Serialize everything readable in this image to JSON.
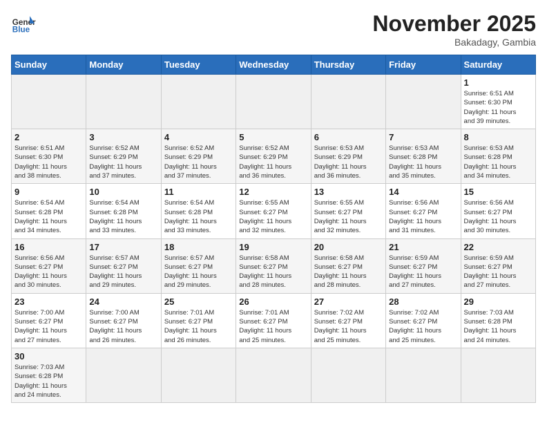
{
  "header": {
    "logo_general": "General",
    "logo_blue": "Blue",
    "month": "November 2025",
    "location": "Bakadagy, Gambia"
  },
  "weekdays": [
    "Sunday",
    "Monday",
    "Tuesday",
    "Wednesday",
    "Thursday",
    "Friday",
    "Saturday"
  ],
  "weeks": [
    [
      {
        "day": "",
        "info": ""
      },
      {
        "day": "",
        "info": ""
      },
      {
        "day": "",
        "info": ""
      },
      {
        "day": "",
        "info": ""
      },
      {
        "day": "",
        "info": ""
      },
      {
        "day": "",
        "info": ""
      },
      {
        "day": "1",
        "info": "Sunrise: 6:51 AM\nSunset: 6:30 PM\nDaylight: 11 hours\nand 39 minutes."
      }
    ],
    [
      {
        "day": "2",
        "info": "Sunrise: 6:51 AM\nSunset: 6:30 PM\nDaylight: 11 hours\nand 38 minutes."
      },
      {
        "day": "3",
        "info": "Sunrise: 6:52 AM\nSunset: 6:29 PM\nDaylight: 11 hours\nand 37 minutes."
      },
      {
        "day": "4",
        "info": "Sunrise: 6:52 AM\nSunset: 6:29 PM\nDaylight: 11 hours\nand 37 minutes."
      },
      {
        "day": "5",
        "info": "Sunrise: 6:52 AM\nSunset: 6:29 PM\nDaylight: 11 hours\nand 36 minutes."
      },
      {
        "day": "6",
        "info": "Sunrise: 6:53 AM\nSunset: 6:29 PM\nDaylight: 11 hours\nand 36 minutes."
      },
      {
        "day": "7",
        "info": "Sunrise: 6:53 AM\nSunset: 6:28 PM\nDaylight: 11 hours\nand 35 minutes."
      },
      {
        "day": "8",
        "info": "Sunrise: 6:53 AM\nSunset: 6:28 PM\nDaylight: 11 hours\nand 34 minutes."
      }
    ],
    [
      {
        "day": "9",
        "info": "Sunrise: 6:54 AM\nSunset: 6:28 PM\nDaylight: 11 hours\nand 34 minutes."
      },
      {
        "day": "10",
        "info": "Sunrise: 6:54 AM\nSunset: 6:28 PM\nDaylight: 11 hours\nand 33 minutes."
      },
      {
        "day": "11",
        "info": "Sunrise: 6:54 AM\nSunset: 6:28 PM\nDaylight: 11 hours\nand 33 minutes."
      },
      {
        "day": "12",
        "info": "Sunrise: 6:55 AM\nSunset: 6:27 PM\nDaylight: 11 hours\nand 32 minutes."
      },
      {
        "day": "13",
        "info": "Sunrise: 6:55 AM\nSunset: 6:27 PM\nDaylight: 11 hours\nand 32 minutes."
      },
      {
        "day": "14",
        "info": "Sunrise: 6:56 AM\nSunset: 6:27 PM\nDaylight: 11 hours\nand 31 minutes."
      },
      {
        "day": "15",
        "info": "Sunrise: 6:56 AM\nSunset: 6:27 PM\nDaylight: 11 hours\nand 30 minutes."
      }
    ],
    [
      {
        "day": "16",
        "info": "Sunrise: 6:56 AM\nSunset: 6:27 PM\nDaylight: 11 hours\nand 30 minutes."
      },
      {
        "day": "17",
        "info": "Sunrise: 6:57 AM\nSunset: 6:27 PM\nDaylight: 11 hours\nand 29 minutes."
      },
      {
        "day": "18",
        "info": "Sunrise: 6:57 AM\nSunset: 6:27 PM\nDaylight: 11 hours\nand 29 minutes."
      },
      {
        "day": "19",
        "info": "Sunrise: 6:58 AM\nSunset: 6:27 PM\nDaylight: 11 hours\nand 28 minutes."
      },
      {
        "day": "20",
        "info": "Sunrise: 6:58 AM\nSunset: 6:27 PM\nDaylight: 11 hours\nand 28 minutes."
      },
      {
        "day": "21",
        "info": "Sunrise: 6:59 AM\nSunset: 6:27 PM\nDaylight: 11 hours\nand 27 minutes."
      },
      {
        "day": "22",
        "info": "Sunrise: 6:59 AM\nSunset: 6:27 PM\nDaylight: 11 hours\nand 27 minutes."
      }
    ],
    [
      {
        "day": "23",
        "info": "Sunrise: 7:00 AM\nSunset: 6:27 PM\nDaylight: 11 hours\nand 27 minutes."
      },
      {
        "day": "24",
        "info": "Sunrise: 7:00 AM\nSunset: 6:27 PM\nDaylight: 11 hours\nand 26 minutes."
      },
      {
        "day": "25",
        "info": "Sunrise: 7:01 AM\nSunset: 6:27 PM\nDaylight: 11 hours\nand 26 minutes."
      },
      {
        "day": "26",
        "info": "Sunrise: 7:01 AM\nSunset: 6:27 PM\nDaylight: 11 hours\nand 25 minutes."
      },
      {
        "day": "27",
        "info": "Sunrise: 7:02 AM\nSunset: 6:27 PM\nDaylight: 11 hours\nand 25 minutes."
      },
      {
        "day": "28",
        "info": "Sunrise: 7:02 AM\nSunset: 6:27 PM\nDaylight: 11 hours\nand 25 minutes."
      },
      {
        "day": "29",
        "info": "Sunrise: 7:03 AM\nSunset: 6:28 PM\nDaylight: 11 hours\nand 24 minutes."
      }
    ],
    [
      {
        "day": "30",
        "info": "Sunrise: 7:03 AM\nSunset: 6:28 PM\nDaylight: 11 hours\nand 24 minutes."
      },
      {
        "day": "",
        "info": ""
      },
      {
        "day": "",
        "info": ""
      },
      {
        "day": "",
        "info": ""
      },
      {
        "day": "",
        "info": ""
      },
      {
        "day": "",
        "info": ""
      },
      {
        "day": "",
        "info": ""
      }
    ]
  ]
}
